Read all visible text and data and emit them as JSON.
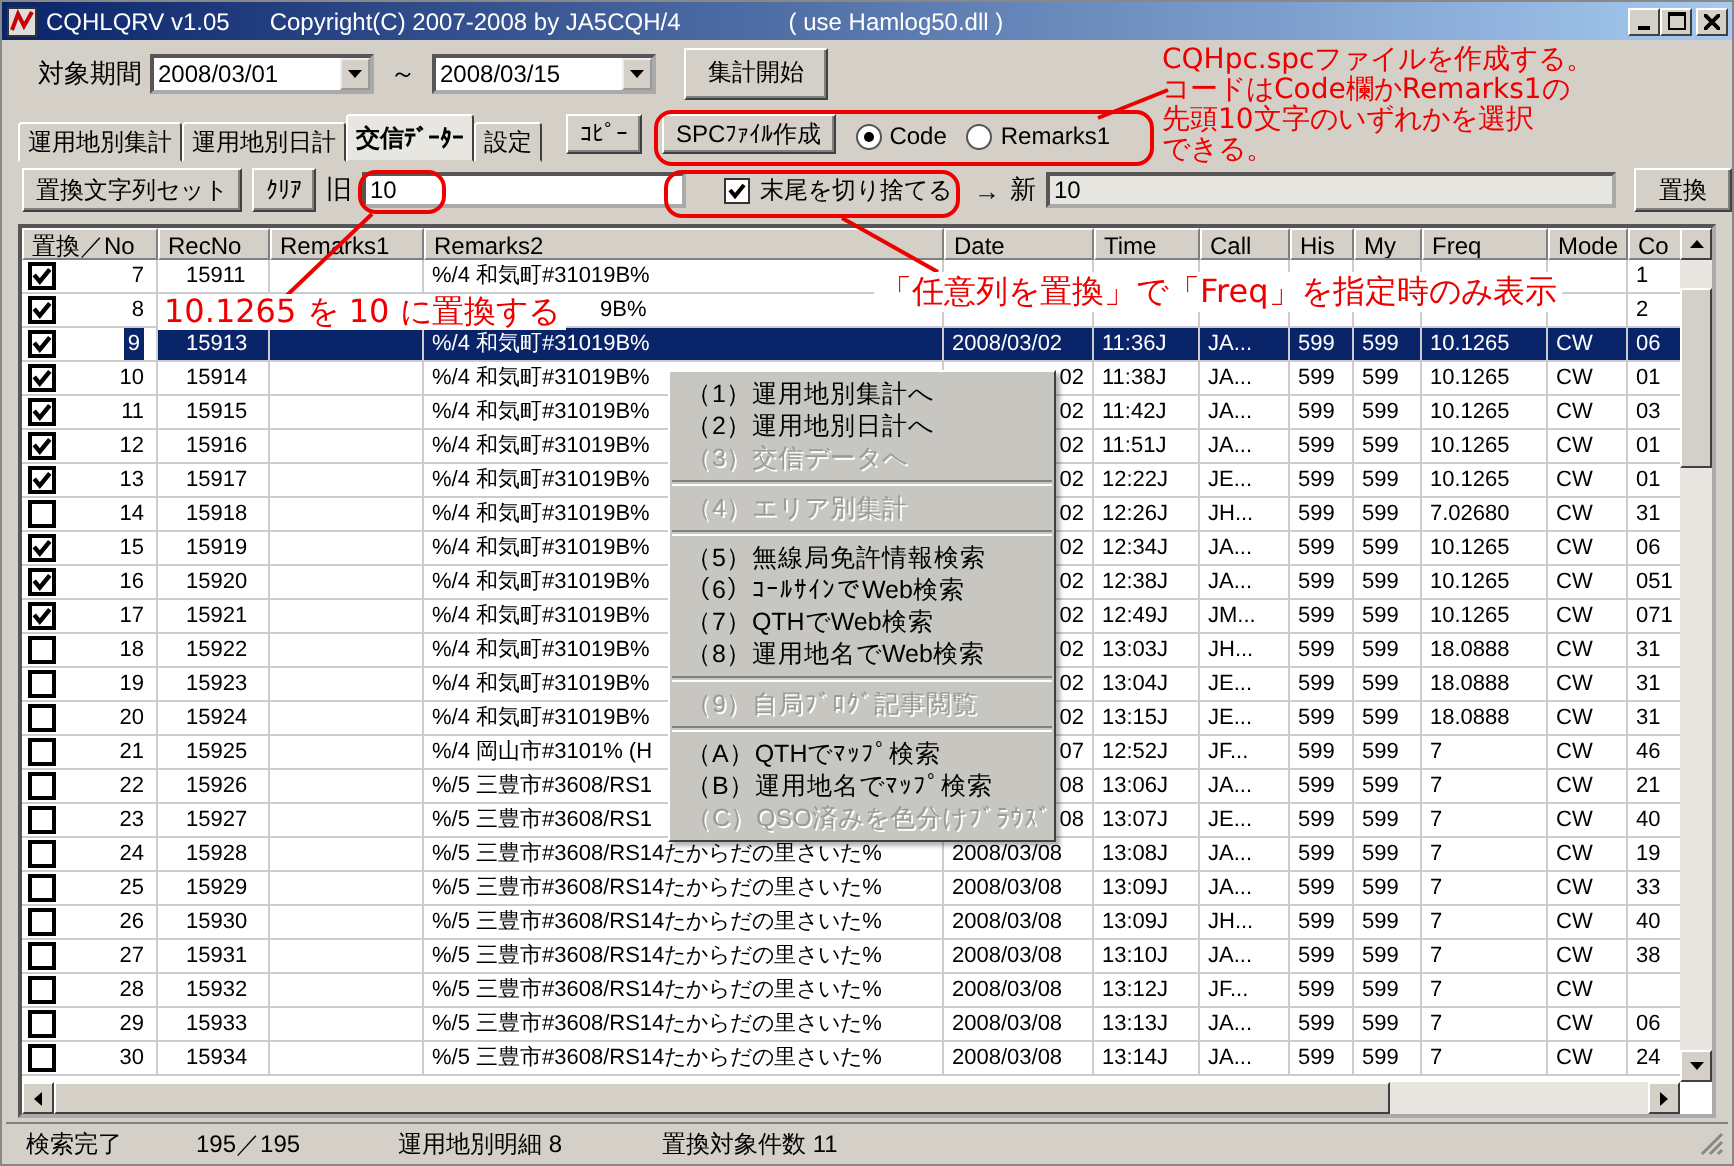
{
  "window": {
    "title": "CQHLQRV  v1.05",
    "copyright": "Copyright(C) 2007-2008  by JA5CQH/4",
    "dll": "( use Hamlog50.dll )"
  },
  "period": {
    "label": "対象期間",
    "from": "2008/03/01",
    "separator": "～",
    "to": "2008/03/15",
    "start_button": "集計開始"
  },
  "tabs": [
    {
      "label": "運用地別集計",
      "selected": false
    },
    {
      "label": "運用地別日計",
      "selected": false
    },
    {
      "label": "交信ﾃﾞｰﾀｰ",
      "selected": true
    },
    {
      "label": "設定",
      "selected": false
    }
  ],
  "copy_button": "ｺﾋﾟｰ",
  "spc_button": "SPCﾌｧｲﾙ作成",
  "radios": [
    {
      "label": "Code",
      "selected": true
    },
    {
      "label": "Remarks1",
      "selected": false
    }
  ],
  "replace": {
    "set_button": "置換文字列セット",
    "clear_button": "ｸﾘｱ",
    "old_label": "旧",
    "old_value": "10",
    "truncate": {
      "label": "末尾を切り捨てる",
      "checked": true
    },
    "arrow": "→",
    "new_label": "新",
    "new_value": "10",
    "replace_button": "置換"
  },
  "table": {
    "columns": [
      "置換／No",
      "RecNo",
      "Remarks1",
      "Remarks2",
      "Date",
      "Time",
      "Call",
      "His",
      "My",
      "Freq",
      "Mode",
      "Co"
    ],
    "rows": [
      {
        "no": "7",
        "checked": true,
        "selected": false,
        "recno": "15911",
        "remarks2": "%/4 和気町#31019B%",
        "code": "1"
      },
      {
        "no": "8",
        "checked": true,
        "selected": false,
        "remarks2": {
          "text": "9B%",
          "cut": true
        },
        "code": "2"
      },
      {
        "no": "9",
        "checked": true,
        "selected": true,
        "recno": "15913",
        "remarks2": "%/4 和気町#31019B%",
        "date": "2008/03/02",
        "time": "11:36J",
        "call": "JA...",
        "his": "599",
        "my": "599",
        "freq": "10.1265",
        "mode": "CW",
        "code": "06"
      },
      {
        "no": "10",
        "checked": true,
        "selected": false,
        "recno": "15914",
        "remarks2": "%/4 和気町#31019B%",
        "date": {
          "text": "02",
          "cut": true
        },
        "time": "11:38J",
        "call": "JA...",
        "his": "599",
        "my": "599",
        "freq": "10.1265",
        "mode": "CW",
        "code": "01"
      },
      {
        "no": "11",
        "checked": true,
        "selected": false,
        "recno": "15915",
        "remarks2": "%/4 和気町#31019B%",
        "date": {
          "text": "02",
          "cut": true
        },
        "time": "11:42J",
        "call": "JA...",
        "his": "599",
        "my": "599",
        "freq": "10.1265",
        "mode": "CW",
        "code": "03"
      },
      {
        "no": "12",
        "checked": true,
        "selected": false,
        "recno": "15916",
        "remarks2": "%/4 和気町#31019B%",
        "date": {
          "text": "02",
          "cut": true
        },
        "time": "11:51J",
        "call": "JA...",
        "his": "599",
        "my": "599",
        "freq": "10.1265",
        "mode": "CW",
        "code": "01"
      },
      {
        "no": "13",
        "checked": true,
        "selected": false,
        "recno": "15917",
        "remarks2": "%/4 和気町#31019B%",
        "date": {
          "text": "02",
          "cut": true
        },
        "time": "12:22J",
        "call": "JE...",
        "his": "599",
        "my": "599",
        "freq": "10.1265",
        "mode": "CW",
        "code": "01"
      },
      {
        "no": "14",
        "checked": false,
        "selected": false,
        "recno": "15918",
        "remarks2": "%/4 和気町#31019B%",
        "date": {
          "text": "02",
          "cut": true
        },
        "time": "12:26J",
        "call": "JH...",
        "his": "599",
        "my": "599",
        "freq": "7.02680",
        "mode": "CW",
        "code": "31"
      },
      {
        "no": "15",
        "checked": true,
        "selected": false,
        "recno": "15919",
        "remarks2": "%/4 和気町#31019B%",
        "date": {
          "text": "02",
          "cut": true
        },
        "time": "12:34J",
        "call": "JA...",
        "his": "599",
        "my": "599",
        "freq": "10.1265",
        "mode": "CW",
        "code": "06"
      },
      {
        "no": "16",
        "checked": true,
        "selected": false,
        "recno": "15920",
        "remarks2": "%/4 和気町#31019B%",
        "date": {
          "text": "02",
          "cut": true
        },
        "time": "12:38J",
        "call": "JA...",
        "his": "599",
        "my": "599",
        "freq": "10.1265",
        "mode": "CW",
        "code": "051"
      },
      {
        "no": "17",
        "checked": true,
        "selected": false,
        "recno": "15921",
        "remarks2": "%/4 和気町#31019B%",
        "date": {
          "text": "02",
          "cut": true
        },
        "time": "12:49J",
        "call": "JM...",
        "his": "599",
        "my": "599",
        "freq": "10.1265",
        "mode": "CW",
        "code": "071"
      },
      {
        "no": "18",
        "checked": false,
        "selected": false,
        "recno": "15922",
        "remarks2": "%/4 和気町#31019B%",
        "date": {
          "text": "02",
          "cut": true
        },
        "time": "13:03J",
        "call": "JH...",
        "his": "599",
        "my": "599",
        "freq": "18.0888",
        "mode": "CW",
        "code": "31"
      },
      {
        "no": "19",
        "checked": false,
        "selected": false,
        "recno": "15923",
        "remarks2": "%/4 和気町#31019B%",
        "date": {
          "text": "02",
          "cut": true
        },
        "time": "13:04J",
        "call": "JE...",
        "his": "599",
        "my": "599",
        "freq": "18.0888",
        "mode": "CW",
        "code": "31"
      },
      {
        "no": "20",
        "checked": false,
        "selected": false,
        "recno": "15924",
        "remarks2": "%/4 和気町#31019B%",
        "date": {
          "text": "02",
          "cut": true
        },
        "time": "13:15J",
        "call": "JE...",
        "his": "599",
        "my": "599",
        "freq": "18.0888",
        "mode": "CW",
        "code": "31"
      },
      {
        "no": "21",
        "checked": false,
        "selected": false,
        "recno": "15925",
        "remarks2": "%/4 岡山市#3101% (H",
        "date": {
          "text": "07",
          "cut": true
        },
        "time": "12:52J",
        "call": "JF...",
        "his": "599",
        "my": "599",
        "freq": "7",
        "mode": "CW",
        "code": "46"
      },
      {
        "no": "22",
        "checked": false,
        "selected": false,
        "recno": "15926",
        "remarks2": "%/5 三豊市#3608/RS1",
        "date": {
          "text": "08",
          "cut": true
        },
        "time": "13:06J",
        "call": "JA...",
        "his": "599",
        "my": "599",
        "freq": "7",
        "mode": "CW",
        "code": "21"
      },
      {
        "no": "23",
        "checked": false,
        "selected": false,
        "recno": "15927",
        "remarks2": "%/5 三豊市#3608/RS1",
        "date": {
          "text": "08",
          "cut": true
        },
        "time": "13:07J",
        "call": "JE...",
        "his": "599",
        "my": "599",
        "freq": "7",
        "mode": "CW",
        "code": "40"
      },
      {
        "no": "24",
        "checked": false,
        "selected": false,
        "recno": "15928",
        "remarks2": "%/5 三豊市#3608/RS14たからだの里さいた%",
        "date": "2008/03/08",
        "time": "13:08J",
        "call": "JA...",
        "his": "599",
        "my": "599",
        "freq": "7",
        "mode": "CW",
        "code": "19"
      },
      {
        "no": "25",
        "checked": false,
        "selected": false,
        "recno": "15929",
        "remarks2": "%/5 三豊市#3608/RS14たからだの里さいた%",
        "date": "2008/03/08",
        "time": "13:09J",
        "call": "JA...",
        "his": "599",
        "my": "599",
        "freq": "7",
        "mode": "CW",
        "code": "33"
      },
      {
        "no": "26",
        "checked": false,
        "selected": false,
        "recno": "15930",
        "remarks2": "%/5 三豊市#3608/RS14たからだの里さいた%",
        "date": "2008/03/08",
        "time": "13:09J",
        "call": "JH...",
        "his": "599",
        "my": "599",
        "freq": "7",
        "mode": "CW",
        "code": "40"
      },
      {
        "no": "27",
        "checked": false,
        "selected": false,
        "recno": "15931",
        "remarks2": "%/5 三豊市#3608/RS14たからだの里さいた%",
        "date": "2008/03/08",
        "time": "13:10J",
        "call": "JA...",
        "his": "599",
        "my": "599",
        "freq": "7",
        "mode": "CW",
        "code": "38"
      },
      {
        "no": "28",
        "checked": false,
        "selected": false,
        "recno": "15932",
        "remarks2": "%/5 三豊市#3608/RS14たからだの里さいた%",
        "date": "2008/03/08",
        "time": "13:12J",
        "call": "JF...",
        "his": "599",
        "my": "599",
        "freq": "7",
        "mode": "CW"
      },
      {
        "no": "29",
        "checked": false,
        "selected": false,
        "recno": "15933",
        "remarks2": "%/5 三豊市#3608/RS14たからだの里さいた%",
        "date": "2008/03/08",
        "time": "13:13J",
        "call": "JA...",
        "his": "599",
        "my": "599",
        "freq": "7",
        "mode": "CW",
        "code": "06"
      },
      {
        "no": "30",
        "checked": false,
        "selected": false,
        "recno": "15934",
        "remarks2": "%/5 三豊市#3608/RS14たからだの里さいた%",
        "date": "2008/03/08",
        "time": "13:14J",
        "call": "JA...",
        "his": "599",
        "my": "599",
        "freq": "7",
        "mode": "CW",
        "code": "24"
      }
    ]
  },
  "context_menu": [
    {
      "kind": "item",
      "text": "（1）運用地別集計へ",
      "enabled": true
    },
    {
      "kind": "item",
      "text": "（2）運用地別日計へ",
      "enabled": true
    },
    {
      "kind": "item",
      "text": "（3）交信データへ",
      "enabled": false
    },
    {
      "kind": "separator"
    },
    {
      "kind": "item",
      "text": "（4）エリア別集計",
      "enabled": false
    },
    {
      "kind": "separator"
    },
    {
      "kind": "item",
      "text": "（5）無線局免許情報検索",
      "enabled": true
    },
    {
      "kind": "item",
      "text": "（6）ｺｰﾙｻｲﾝでWeb検索",
      "enabled": true
    },
    {
      "kind": "item",
      "text": "（7）QTHでWeb検索",
      "enabled": true
    },
    {
      "kind": "item",
      "text": "（8）運用地名でWeb検索",
      "enabled": true
    },
    {
      "kind": "separator"
    },
    {
      "kind": "item",
      "text": "（9）自局ﾌﾞﾛｸﾞ記事閲覧",
      "enabled": false
    },
    {
      "kind": "separator"
    },
    {
      "kind": "item",
      "text": "（A）QTHでﾏｯﾌﾟ検索",
      "enabled": true
    },
    {
      "kind": "item",
      "text": "（B）運用地名でﾏｯﾌﾟ検索",
      "enabled": true
    },
    {
      "kind": "item",
      "text": "（C）QSO済みを色分けﾌﾞﾗｳｽﾞ",
      "enabled": false
    }
  ],
  "notes": [
    {
      "lines": [
        "CQHpc.spcファイルを作成する。",
        "コードはCode欄かRemarks1の",
        "先頭10文字のいずれかを選択",
        "できる。"
      ]
    },
    {
      "lines": [
        "10.1265 を 10 に置換する"
      ]
    },
    {
      "lines": [
        "「任意列を置換」で「Freq」を指定時のみ表示"
      ]
    }
  ],
  "status_bar": [
    "検索完了",
    "195／195",
    "運用地別明細 8",
    "置換対象件数 11"
  ]
}
